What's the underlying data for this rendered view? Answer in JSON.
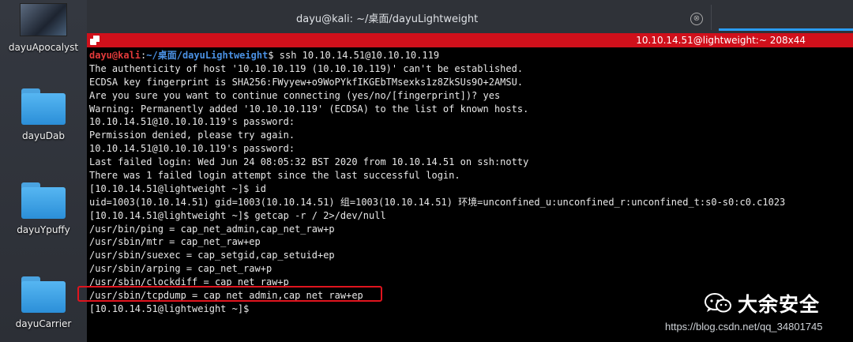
{
  "desktop": {
    "items": [
      {
        "label": "dayuApocalyst",
        "icon": "image-thumbnail-icon"
      },
      {
        "label": "dayuDab",
        "icon": "folder-icon"
      },
      {
        "label": "dayuYpuffy",
        "icon": "folder-icon"
      },
      {
        "label": "dayuCarrier",
        "icon": "folder-icon"
      }
    ]
  },
  "window": {
    "title": "dayu@kali: ~/桌面/dayuLightweight",
    "close_glyph": "⊗"
  },
  "status": {
    "text": "10.10.14.51@lightweight:~ 208x44",
    "bar_color": "#d0101b"
  },
  "terminal": {
    "prompt_user": "dayu@kali",
    "prompt_colon": ":",
    "prompt_path": "~/桌面/dayuLightweight",
    "prompt_cmd": "$ ssh 10.10.14.51@10.10.10.119",
    "lines": [
      "The authenticity of host '10.10.10.119 (10.10.10.119)' can't be established.",
      "ECDSA key fingerprint is SHA256:FWyyew+o9WoPYkfIKGEbTMsexks1z8ZkSUs9O+2AMSU.",
      "Are you sure you want to continue connecting (yes/no/[fingerprint])? yes",
      "Warning: Permanently added '10.10.10.119' (ECDSA) to the list of known hosts.",
      "10.10.14.51@10.10.10.119's password:",
      "Permission denied, please try again.",
      "10.10.14.51@10.10.10.119's password:",
      "Last failed login: Wed Jun 24 08:05:32 BST 2020 from 10.10.14.51 on ssh:notty",
      "There was 1 failed login attempt since the last successful login.",
      "[10.10.14.51@lightweight ~]$ id",
      "uid=1003(10.10.14.51) gid=1003(10.10.14.51) 组=1003(10.10.14.51) 环境=unconfined_u:unconfined_r:unconfined_t:s0-s0:c0.c1023",
      "[10.10.14.51@lightweight ~]$ getcap -r / 2>/dev/null",
      "/usr/bin/ping = cap_net_admin,cap_net_raw+p",
      "/usr/sbin/mtr = cap_net_raw+ep",
      "/usr/sbin/suexec = cap_setgid,cap_setuid+ep",
      "/usr/sbin/arping = cap_net_raw+p",
      "/usr/sbin/clockdiff = cap_net_raw+p",
      "/usr/sbin/tcpdump = cap_net_admin,cap_net_raw+ep",
      "[10.10.14.51@lightweight ~]$"
    ]
  },
  "watermark": {
    "brand": "大余安全",
    "icon": "wechat-icon",
    "url": "https://blog.csdn.net/qq_34801745"
  }
}
